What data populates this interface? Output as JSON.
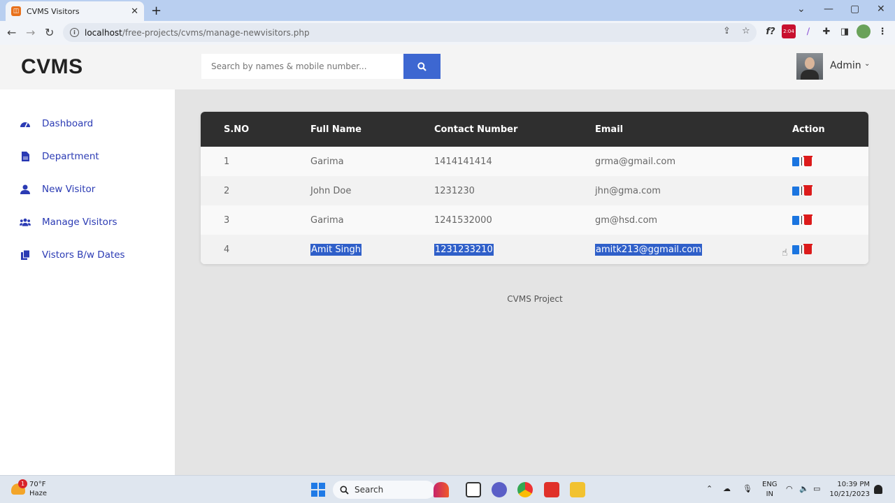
{
  "browser": {
    "tab_title": "CVMS Visitors",
    "url_host": "localhost",
    "url_path": "/free-projects/cvms/manage-newvisitors.php",
    "rec_label": "2:04"
  },
  "app": {
    "brand": "CVMS",
    "search": {
      "placeholder": "Search by names & mobile number..."
    },
    "user": {
      "name": "Admin"
    },
    "sidebar": {
      "items": [
        {
          "label": "Dashboard",
          "icon": "dashboard-icon"
        },
        {
          "label": "Department",
          "icon": "file-icon"
        },
        {
          "label": "New Visitor",
          "icon": "user-icon"
        },
        {
          "label": "Manage Visitors",
          "icon": "users-icon"
        },
        {
          "label": "Vistors B/w Dates",
          "icon": "copy-icon"
        }
      ]
    },
    "table": {
      "headers": [
        "S.NO",
        "Full Name",
        "Contact Number",
        "Email",
        "Action"
      ],
      "rows": [
        {
          "sno": "1",
          "name": "Garima",
          "contact": "1414141414",
          "email": "grma@gmail.com"
        },
        {
          "sno": "2",
          "name": "John Doe",
          "contact": "1231230",
          "email": "jhn@gma.com"
        },
        {
          "sno": "3",
          "name": "Garima",
          "contact": "1241532000",
          "email": "gm@hsd.com"
        },
        {
          "sno": "4",
          "name": "Amit Singh",
          "contact": "1231233210",
          "email": "amitk213@ggmail.com"
        }
      ]
    },
    "footer": "CVMS Project"
  },
  "taskbar": {
    "weather_temp": "70°F",
    "weather_desc": "Haze",
    "weather_badge": "1",
    "search_label": "Search",
    "lang_top": "ENG",
    "lang_bottom": "IN",
    "time": "10:39 PM",
    "date": "10/21/2023"
  },
  "colors": {
    "accent": "#3d67d1",
    "sidebar_link": "#2b3bb4",
    "table_header": "#2f2f2f",
    "selection": "#2f5fc9",
    "edit": "#1b75e0",
    "delete": "#dc1b1b"
  }
}
